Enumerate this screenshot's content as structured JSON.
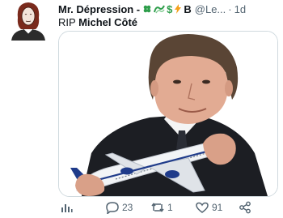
{
  "tweet": {
    "author_name": "Mr. Dépression -",
    "handle": "@Le...",
    "separator": "·",
    "time": "1d",
    "badges": {
      "clover": "☘",
      "dollar": "$",
      "lightning": "⚡",
      "bitcoin": "B"
    },
    "caption_prefix": "RIP",
    "caption_name": "Michel Côté"
  },
  "actions": {
    "replies": "23",
    "retweets": "1",
    "likes": "91"
  },
  "colors": {
    "muted": "#536471",
    "text": "#0f1419",
    "border": "#cfd9de",
    "clover": "#2e9e4b",
    "lightning": "#f4a11c"
  }
}
